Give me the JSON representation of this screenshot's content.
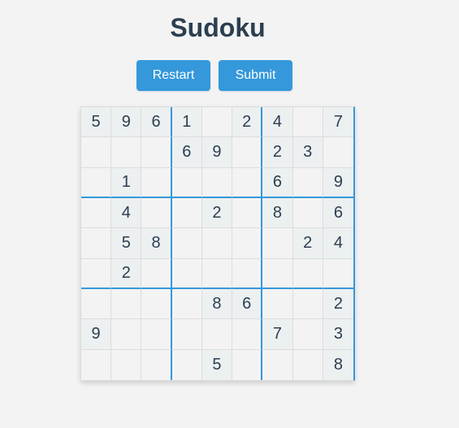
{
  "title": "Sudoku",
  "buttons": {
    "restart": "Restart",
    "submit": "Submit"
  },
  "colors": {
    "accent": "#3498db",
    "text": "#2c3e50",
    "given_cell_bg": "#ecf0f1",
    "page_bg": "#f3f3f3"
  },
  "board": [
    [
      "5",
      "9",
      "6",
      "1",
      "",
      "2",
      "4",
      "",
      "7"
    ],
    [
      "",
      "",
      "",
      "6",
      "9",
      "",
      "2",
      "3",
      ""
    ],
    [
      "",
      "1",
      "",
      "",
      "",
      "",
      "6",
      "",
      "9"
    ],
    [
      "",
      "4",
      "",
      "",
      "2",
      "",
      "8",
      "",
      "6"
    ],
    [
      "",
      "5",
      "8",
      "",
      "",
      "",
      "",
      "2",
      "4"
    ],
    [
      "",
      "2",
      "",
      "",
      "",
      "",
      "",
      "",
      ""
    ],
    [
      "",
      "",
      "",
      "",
      "8",
      "6",
      "",
      "",
      "2"
    ],
    [
      "9",
      "",
      "",
      "",
      "",
      "",
      "7",
      "",
      "3"
    ],
    [
      "",
      "",
      "",
      "",
      "5",
      "",
      "",
      "",
      "8"
    ]
  ]
}
